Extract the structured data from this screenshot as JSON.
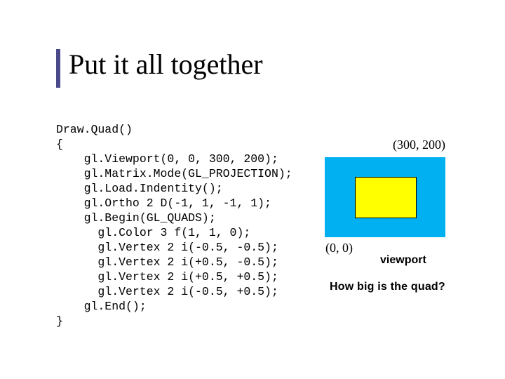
{
  "title": "Put it all together",
  "code": "Draw.Quad()\n{\n    gl.Viewport(0, 0, 300, 200);\n    gl.Matrix.Mode(GL_PROJECTION);\n    gl.Load.Indentity();\n    gl.Ortho 2 D(-1, 1, -1, 1);\n    gl.Begin(GL_QUADS);\n      gl.Color 3 f(1, 1, 0);\n      gl.Vertex 2 i(-0.5, -0.5);\n      gl.Vertex 2 i(+0.5, -0.5);\n      gl.Vertex 2 i(+0.5, +0.5);\n      gl.Vertex 2 i(-0.5, +0.5);\n    gl.End();\n}",
  "diagram": {
    "top_right_coord": "(300, 200)",
    "bottom_left_coord": "(0, 0)",
    "viewport_label": "viewport",
    "viewport_bg": "#00b0f0",
    "quad_fill": "#ffff00"
  },
  "question": "How  big is the quad?"
}
